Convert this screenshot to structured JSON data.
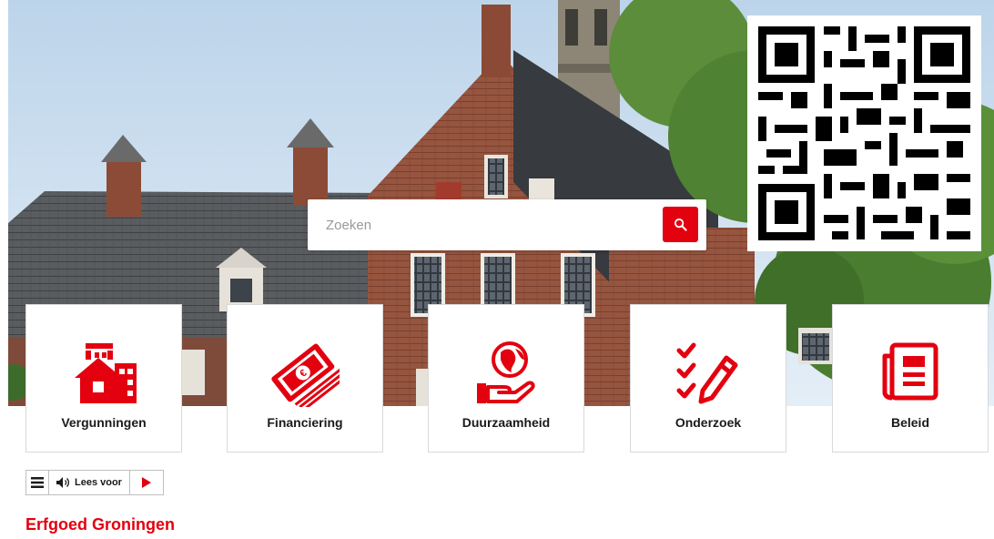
{
  "search": {
    "placeholder": "Zoeken",
    "button_icon": "search-icon"
  },
  "tiles": [
    {
      "label": "Vergunningen",
      "icon": "building-house-icon"
    },
    {
      "label": "Financiering",
      "icon": "money-euro-icon"
    },
    {
      "label": "Duurzaamheid",
      "icon": "globe-hand-icon"
    },
    {
      "label": "Onderzoek",
      "icon": "checklist-pencil-icon"
    },
    {
      "label": "Beleid",
      "icon": "newspaper-icon"
    }
  ],
  "readspeaker": {
    "menu_icon": "menu-icon",
    "label": "Lees voor",
    "speaker_icon": "speaker-icon",
    "play_icon": "play-icon"
  },
  "page_title": "Erfgoed Groningen",
  "colors": {
    "accent": "#e3000f",
    "text": "#1a1a1a"
  }
}
